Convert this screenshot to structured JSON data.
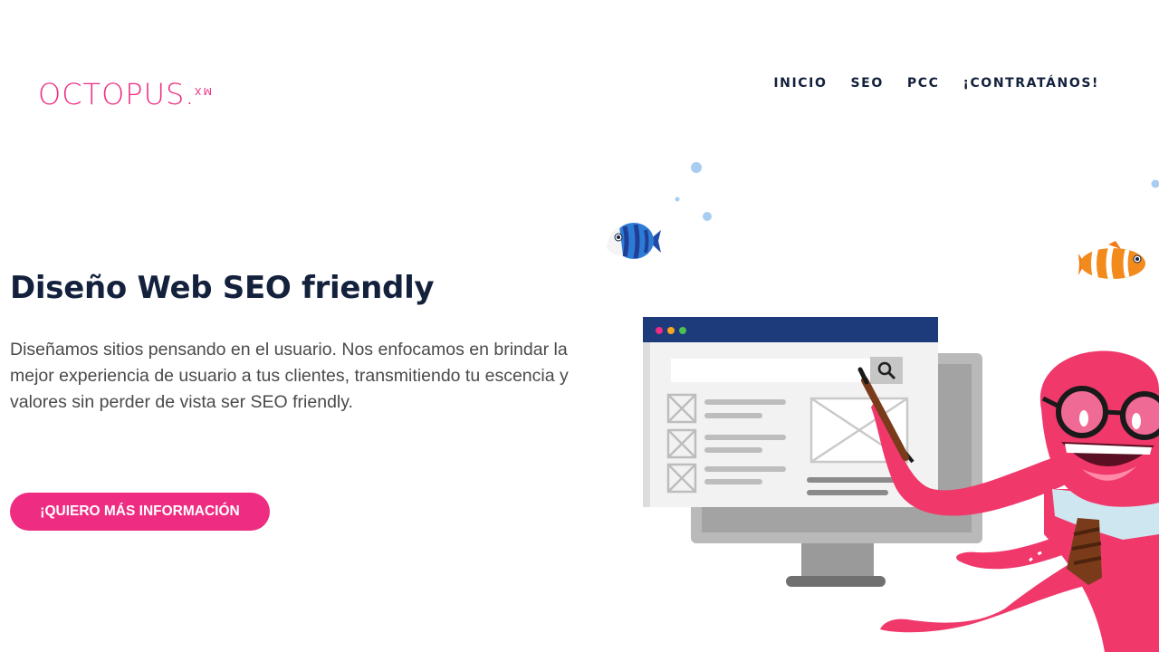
{
  "header": {
    "logo_text": "OCTOPUS.",
    "logo_tld": "MX",
    "nav": [
      "INICIO",
      "SEO",
      "PCC",
      "¡CONTRATÁNOS!"
    ]
  },
  "hero": {
    "title": "Diseño Web SEO friendly",
    "description": "Diseñamos sitios pensando en el usuario. Nos enfocamos en brindar la mejor experiencia de usuario a tus clientes, transmitiendo tu escencia y valores sin perder de vista ser SEO friendly.",
    "cta_label": "¡QUIERO MÁS INFORMACIÓN"
  },
  "colors": {
    "brand_pink": "#ee2d82",
    "navy": "#14213d",
    "octopus": "#f0386b",
    "browser_bar": "#1d3a7a"
  },
  "illustration": {
    "icons": [
      "blue-tang-fish-icon",
      "clownfish-icon",
      "bubble-icon",
      "search-icon",
      "octopus-mascot"
    ]
  }
}
